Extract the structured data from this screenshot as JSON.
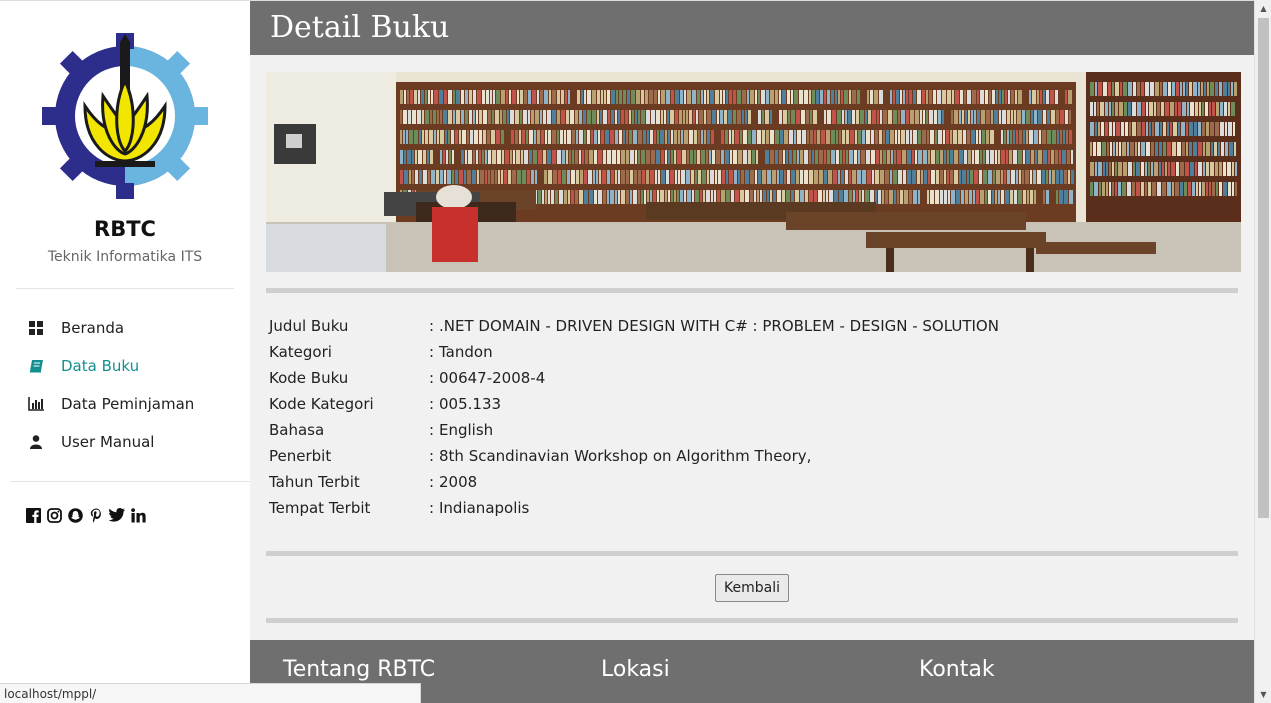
{
  "sidebar": {
    "brand": "RBTC",
    "subtitle": "Teknik Informatika ITS",
    "nav": [
      {
        "label": "Beranda",
        "icon": "dashboard-icon"
      },
      {
        "label": "Data Buku",
        "icon": "book-icon",
        "active": true
      },
      {
        "label": "Data Peminjaman",
        "icon": "bar-chart-icon"
      },
      {
        "label": "User Manual",
        "icon": "user-icon"
      }
    ],
    "social": [
      "facebook-icon",
      "instagram-icon",
      "snapchat-icon",
      "pinterest-icon",
      "twitter-icon",
      "linkedin-icon"
    ]
  },
  "header": {
    "title": "Detail Buku"
  },
  "details": [
    {
      "key": "Judul Buku",
      "sep": ":",
      "value": ".NET DOMAIN - DRIVEN DESIGN WITH C# : PROBLEM - DESIGN - SOLUTION"
    },
    {
      "key": "Kategori",
      "sep": ":",
      "value": "Tandon"
    },
    {
      "key": "Kode Buku",
      "sep": ":",
      "value": "00647-2008-4"
    },
    {
      "key": "Kode Kategori",
      "sep": ":",
      "value": "005.133"
    },
    {
      "key": "Bahasa",
      "sep": ":",
      "value": "English"
    },
    {
      "key": "Penerbit",
      "sep": ":",
      "value": "8th Scandinavian Workshop on Algorithm Theory,"
    },
    {
      "key": "Tahun Terbit",
      "sep": ":",
      "value": "2008"
    },
    {
      "key": "Tempat Terbit",
      "sep": ":",
      "value": "Indianapolis"
    }
  ],
  "back_button": "Kembali",
  "footer": {
    "col1": "Tentang RBTC",
    "col2": "Lokasi",
    "col3": "Kontak"
  },
  "status_url": "localhost/mppl/",
  "colors": {
    "header_bg": "#6f6f6f",
    "active_nav": "#148f8f",
    "logo_blue": "#2d2d8c",
    "logo_lightblue": "#6ab4e0",
    "logo_yellow": "#f2e600"
  }
}
